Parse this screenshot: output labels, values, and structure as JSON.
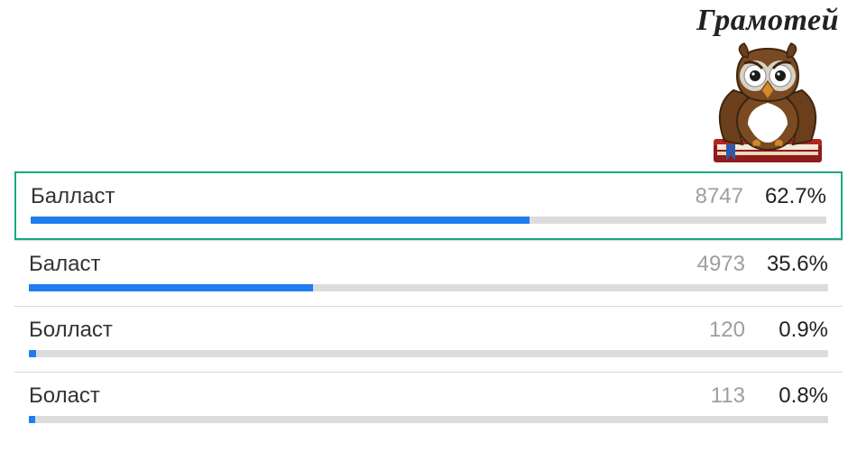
{
  "brand": {
    "title": "Грамотей"
  },
  "chart_data": {
    "type": "bar",
    "title": "Грамотей",
    "xlabel": "",
    "ylabel": "",
    "ylim": [
      0,
      100
    ],
    "categories": [
      "Балласт",
      "Баласт",
      "Болласт",
      "Боласт"
    ],
    "series": [
      {
        "name": "votes",
        "values": [
          8747,
          4973,
          120,
          113
        ]
      },
      {
        "name": "percent",
        "values": [
          62.7,
          35.6,
          0.9,
          0.8
        ]
      }
    ],
    "correct_index": 0
  },
  "options": [
    {
      "label": "Балласт",
      "count": "8747",
      "percent": "62.7%",
      "bar": "62.7%",
      "correct": true
    },
    {
      "label": "Баласт",
      "count": "4973",
      "percent": "35.6%",
      "bar": "35.6%"
    },
    {
      "label": "Болласт",
      "count": "120",
      "percent": "0.9%",
      "bar": "0.9%"
    },
    {
      "label": "Боласт",
      "count": "113",
      "percent": "0.8%",
      "bar": "0.8%"
    }
  ]
}
